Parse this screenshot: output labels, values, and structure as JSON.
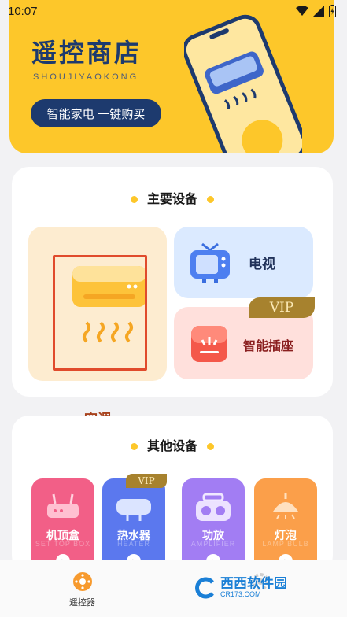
{
  "status_bar": {
    "time": "10:07"
  },
  "banner": {
    "title": "遥控商店",
    "subtitle": "SHOUJIYAOKONG",
    "cta": "智能家电  一键购买"
  },
  "main_section": {
    "title": "主要设备",
    "devices": [
      {
        "label": "空调",
        "icon": "air-conditioner-icon"
      },
      {
        "label": "电视",
        "icon": "tv-icon"
      },
      {
        "label": "智能插座",
        "icon": "smart-socket-icon",
        "badge": "VIP"
      }
    ]
  },
  "other_section": {
    "title": "其他设备",
    "devices": [
      {
        "label": "机顶盒",
        "sub": "SET TOP BOX",
        "color": "#f25f87"
      },
      {
        "label": "热水器",
        "sub": "HEATER",
        "color": "#5b78ee",
        "badge": "VIP"
      },
      {
        "label": "功放",
        "sub": "AMPLIFIER",
        "color": "#a27df3"
      },
      {
        "label": "灯泡",
        "sub": "LAMP BULB",
        "color": "#fb9f4a"
      }
    ]
  },
  "bottom_nav": {
    "items": [
      {
        "label": "遥控器",
        "icon": "remote-control-icon",
        "active": true
      },
      {
        "label": "",
        "icon": "settings-icon",
        "active": false
      }
    ]
  },
  "watermark": {
    "text": "西西软件园",
    "url": "CR173.COM"
  },
  "colors": {
    "accent": "#fdc72a",
    "navy": "#1d3a6e",
    "highlight": "#e04b2c"
  }
}
